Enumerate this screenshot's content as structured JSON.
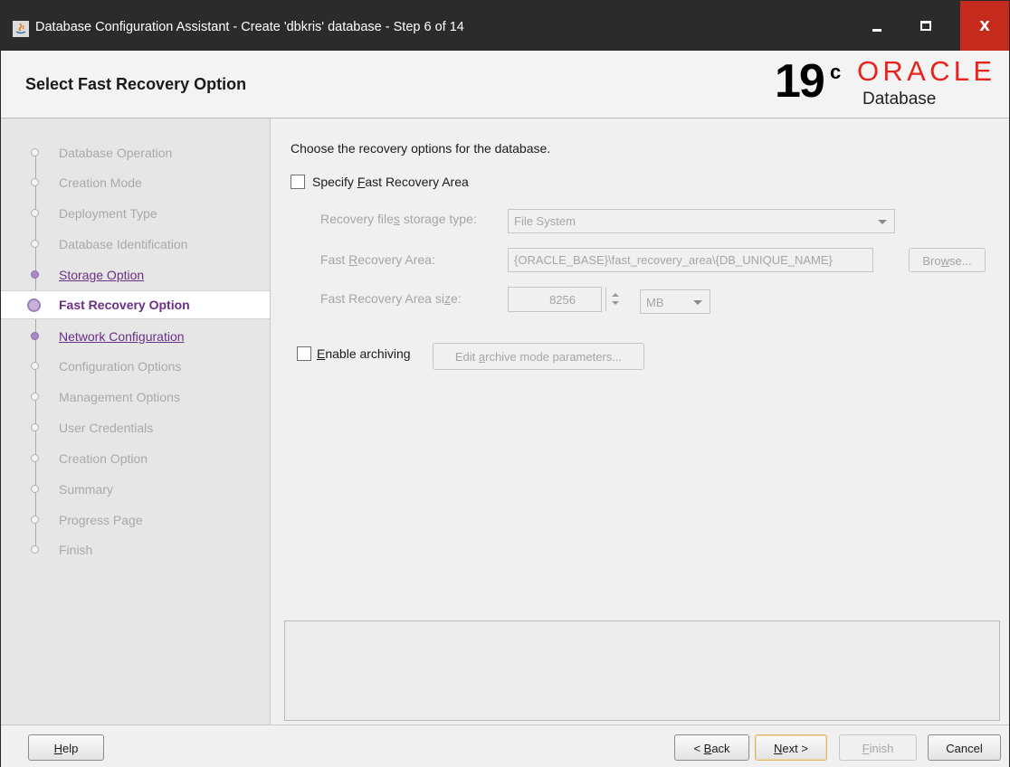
{
  "window": {
    "title": "Database Configuration Assistant - Create 'dbkris' database - Step 6 of 14",
    "minimize_glyph": "",
    "maximize_glyph": "",
    "close_glyph": "X"
  },
  "header": {
    "page_title": "Select Fast Recovery Option",
    "version_number": "19",
    "version_suffix": "c",
    "brand": "ORACLE",
    "product": "Database",
    "brand_color": "#e8231e"
  },
  "steps": [
    {
      "label": "Database Operation",
      "state": "disabled"
    },
    {
      "label": "Creation Mode",
      "state": "disabled"
    },
    {
      "label": "Deployment Type",
      "state": "disabled"
    },
    {
      "label": "Database Identification",
      "state": "disabled"
    },
    {
      "label": "Storage Option",
      "state": "visited"
    },
    {
      "label": "Fast Recovery Option",
      "state": "current"
    },
    {
      "label": "Network Configuration",
      "state": "visited"
    },
    {
      "label": "Configuration Options",
      "state": "disabled"
    },
    {
      "label": "Management Options",
      "state": "disabled"
    },
    {
      "label": "User Credentials",
      "state": "disabled"
    },
    {
      "label": "Creation Option",
      "state": "disabled"
    },
    {
      "label": "Summary",
      "state": "disabled"
    },
    {
      "label": "Progress Page",
      "state": "disabled"
    },
    {
      "label": "Finish",
      "state": "disabled"
    }
  ],
  "content": {
    "instruction": "Choose the recovery options for the database.",
    "specify_fra": {
      "label": "Specify Fast Recovery Area",
      "mnemonic": "F",
      "checked": false
    },
    "storage_type": {
      "label": "Recovery files storage type:",
      "mnemonic": "s",
      "value": "File System"
    },
    "fra_location": {
      "label": "Fast Recovery Area:",
      "mnemonic": "R",
      "value": "{ORACLE_BASE}\\fast_recovery_area\\{DB_UNIQUE_NAME}",
      "browse_label": "Browse...",
      "browse_mnemonic": "w"
    },
    "fra_size": {
      "label": "Fast Recovery Area size:",
      "mnemonic": "z",
      "value": "8256",
      "unit": "MB"
    },
    "archiving": {
      "label": "Enable archiving",
      "mnemonic": "E",
      "checked": false,
      "edit_button": "Edit archive mode parameters...",
      "edit_mnemonic": "a"
    }
  },
  "footer": {
    "help": "Help",
    "help_mnemonic": "H",
    "back": "< Back",
    "back_mnemonic": "B",
    "next": "Next >",
    "next_mnemonic": "N",
    "finish": "Finish",
    "finish_mnemonic": "F",
    "cancel": "Cancel"
  }
}
